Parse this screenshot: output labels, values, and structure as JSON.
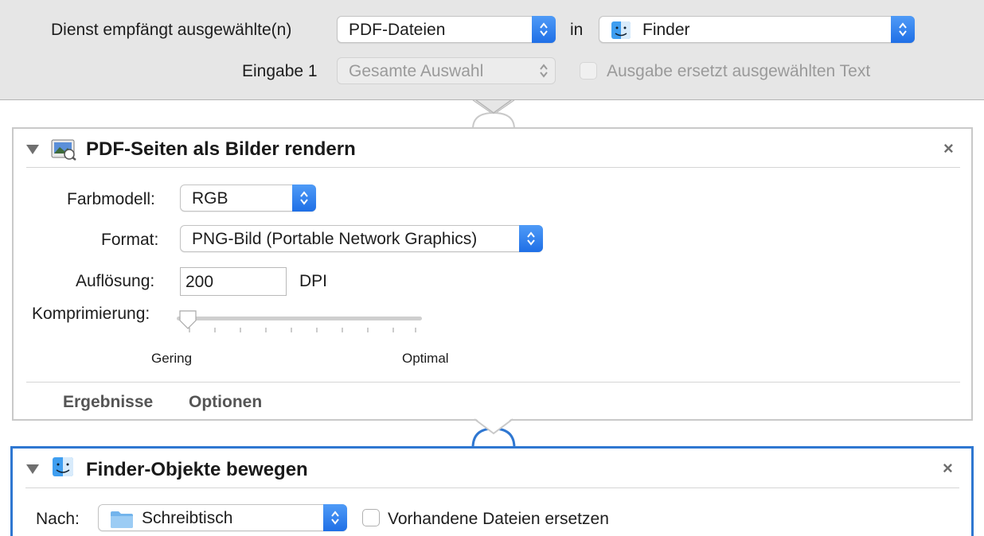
{
  "header": {
    "service_label": "Dienst empfängt ausgewählte(n)",
    "input_type": "PDF-Dateien",
    "in_label": "in",
    "app": "Finder",
    "input_label": "Eingabe 1",
    "input_scope": "Gesamte Auswahl",
    "replace_text_label": "Ausgabe ersetzt ausgewählten Text"
  },
  "action1": {
    "title": "PDF-Seiten als Bilder rendern",
    "color_model_label": "Farbmodell:",
    "color_model": "RGB",
    "format_label": "Format:",
    "format": "PNG-Bild (Portable Network Graphics)",
    "resolution_label": "Auflösung:",
    "resolution": "200",
    "resolution_unit": "DPI",
    "compression_label": "Komprimierung:",
    "compression_min": "Gering",
    "compression_max": "Optimal",
    "compression_value": 0,
    "tab_results": "Ergebnisse",
    "tab_options": "Optionen"
  },
  "action2": {
    "title": "Finder-Objekte bewegen",
    "to_label": "Nach:",
    "destination": "Schreibtisch",
    "replace_label": "Vorhandene Dateien ersetzen"
  },
  "colors": {
    "accent": "#2f77d1",
    "header_bg": "#e6e6e6"
  },
  "icons": [
    "finder-icon",
    "preview-icon",
    "folder-icon",
    "close-icon",
    "disclosure-triangle-icon",
    "popup-stepper-icon"
  ]
}
